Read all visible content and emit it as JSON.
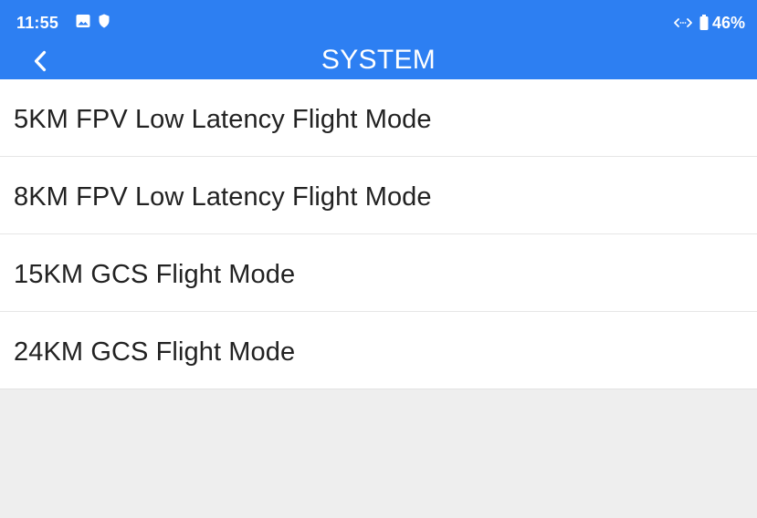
{
  "status_bar": {
    "time": "11:55",
    "battery": "46%",
    "icons": [
      "image-icon",
      "shield-icon",
      "network-icon",
      "battery-icon"
    ]
  },
  "header": {
    "title": "SYSTEM",
    "back_icon": "chevron-left-icon"
  },
  "colors": {
    "header_bg": "#2d7ff2",
    "list_bg": "#ffffff",
    "page_bg": "#eeeeee",
    "text": "#222222"
  },
  "modes": [
    {
      "label": "5KM FPV Low Latency Flight Mode"
    },
    {
      "label": "8KM FPV Low Latency Flight Mode"
    },
    {
      "label": "15KM GCS Flight Mode"
    },
    {
      "label": "24KM GCS Flight Mode"
    }
  ]
}
